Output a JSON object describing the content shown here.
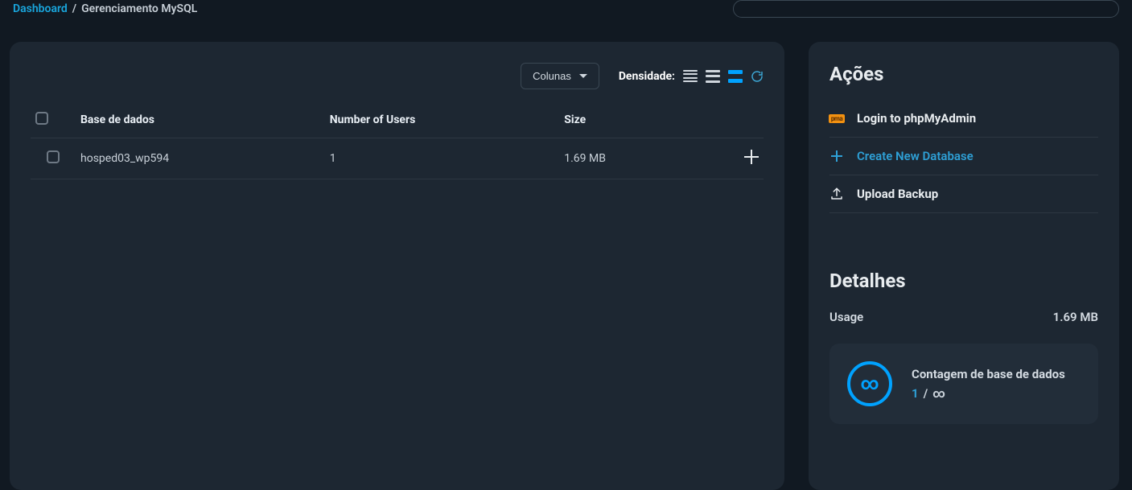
{
  "breadcrumb": {
    "root": "Dashboard",
    "sep": "/",
    "current": "Gerenciamento MySQL"
  },
  "toolbar": {
    "columns_btn": "Colunas",
    "density_label": "Densidade:"
  },
  "table": {
    "headers": {
      "db": "Base de dados",
      "users": "Number of Users",
      "size": "Size"
    },
    "rows": [
      {
        "db": "hosped03_wp594",
        "users": "1",
        "size": "1.69 MB"
      }
    ]
  },
  "side": {
    "actions_title": "Ações",
    "actions": {
      "phpmyadmin": "Login to phpMyAdmin",
      "create_db": "Create New Database",
      "upload_backup": "Upload Backup"
    },
    "details_title": "Detalhes",
    "usage_label": "Usage",
    "usage_value": "1.69 MB",
    "count_label": "Contagem de base de dados",
    "count_value": "1",
    "count_sep": "/",
    "count_total": "∞",
    "ring_glyph": "∞"
  }
}
